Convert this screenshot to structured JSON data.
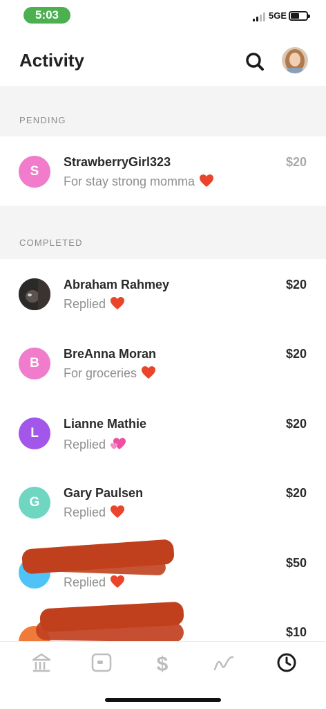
{
  "status_bar": {
    "time": "5:03",
    "network": "5GE"
  },
  "header": {
    "title": "Activity"
  },
  "sections": {
    "pending_label": "PENDING",
    "completed_label": "COMPLETED"
  },
  "pending": [
    {
      "initial": "S",
      "name": "StrawberryGirl323",
      "note": "For stay strong momma",
      "amount": "$20",
      "emoji": "red-heart",
      "avatar_color": "#f07ccb"
    }
  ],
  "completed": [
    {
      "initial": "",
      "name": "Abraham Rahmey",
      "note": "Replied",
      "amount": "$20",
      "emoji": "red-heart",
      "avatar": "photo"
    },
    {
      "initial": "B",
      "name": "BreAnna Moran",
      "note": "For groceries",
      "amount": "$20",
      "emoji": "red-heart",
      "avatar_color": "#f07ccb"
    },
    {
      "initial": "L",
      "name": "Lianne Mathie",
      "note": "Replied",
      "amount": "$20",
      "emoji": "sparkling-heart",
      "avatar_color": "#a257ea"
    },
    {
      "initial": "G",
      "name": "Gary Paulsen",
      "note": "Replied",
      "amount": "$20",
      "emoji": "red-heart",
      "avatar_color": "#6fd6c2"
    },
    {
      "initial": "",
      "name": "",
      "note": "Replied",
      "amount": "$50",
      "emoji": "red-heart",
      "avatar_color": "#4fc3f7",
      "redacted": true
    },
    {
      "initial": "",
      "name": "",
      "note": "",
      "amount": "$10",
      "emoji": "",
      "avatar_color": "#f07a3a",
      "redacted": true
    }
  ],
  "tab_bar": [
    {
      "icon": "bank-icon",
      "active": false
    },
    {
      "icon": "card-icon",
      "active": false
    },
    {
      "icon": "dollar-icon",
      "active": false
    },
    {
      "icon": "investing-icon",
      "active": false
    },
    {
      "icon": "clock-icon",
      "active": true
    }
  ],
  "colors": {
    "brand_green": "#4caf50",
    "section_bg": "#f4f4f4",
    "heart_red": "#e8452c",
    "redaction": "#c0401e"
  }
}
